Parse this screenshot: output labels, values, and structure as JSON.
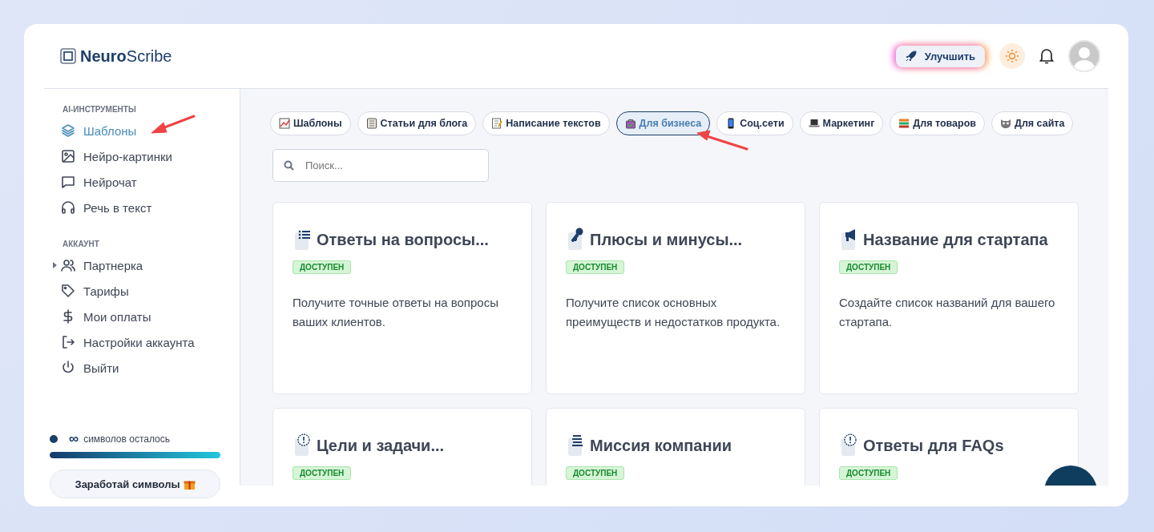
{
  "brand": {
    "name": "**Neuro**Scribe"
  },
  "header": {
    "upgrade_button": "Улучшить"
  },
  "sidebar": {
    "sections": [
      {
        "title": "AI-ИНСТРУМЕНТЫ",
        "items": [
          {
            "label": "Шаблоны",
            "kind": "link",
            "selected": true
          },
          {
            "label": "Нейро-картинки",
            "kind": "link",
            "selected": false
          },
          {
            "label": "Нейрочат",
            "kind": "link",
            "selected": false
          },
          {
            "label": "Речь в текст",
            "kind": "link",
            "selected": false
          }
        ]
      },
      {
        "title": "АККАУНТ",
        "items": [
          {
            "label": "Партнерка",
            "kind": "group",
            "selected": false
          },
          {
            "label": "Тарифы",
            "kind": "link",
            "selected": false
          },
          {
            "label": "Мои оплаты",
            "kind": "link",
            "selected": false
          },
          {
            "label": "Настройки аккаунта",
            "kind": "link",
            "selected": false
          },
          {
            "label": "Выйти",
            "kind": "link",
            "selected": false
          }
        ]
      }
    ],
    "credits": {
      "amount": "∞",
      "label": "символов осталось",
      "level": 1
    },
    "earn_button": "Заработай символы"
  },
  "categories": [
    {
      "label": "Шаблоны",
      "selected": false
    },
    {
      "label": "Статьи для блога",
      "selected": false
    },
    {
      "label": "Написание текстов",
      "selected": false
    },
    {
      "label": "Для бизнеса",
      "selected": true
    },
    {
      "label": "Соц.сети",
      "selected": false
    },
    {
      "label": "Маркетинг",
      "selected": false
    },
    {
      "label": "Для товаров",
      "selected": false
    },
    {
      "label": "Для сайта",
      "selected": false
    }
  ],
  "search": {
    "placeholder": "Поиск..."
  },
  "cards": [
    {
      "title": "Ответы на вопросы...",
      "badge": "ДОСТУПЕН",
      "description": "Получите точные ответы на вопросы ваших клиентов."
    },
    {
      "title": "Плюсы и минусы...",
      "badge": "ДОСТУПЕН",
      "description": "Получите список основных преимуществ и недостатков продукта."
    },
    {
      "title": "Название для стартапа",
      "badge": "ДОСТУПЕН",
      "description": "Создайте список названий для вашего стартапа."
    },
    {
      "title": "Цели и задачи...",
      "badge": "ДОСТУПЕН"
    },
    {
      "title": "Миссия компании",
      "badge": "ДОСТУПЕН"
    },
    {
      "title": "Ответы для FAQs",
      "badge": "ДОСТУПЕН"
    }
  ]
}
